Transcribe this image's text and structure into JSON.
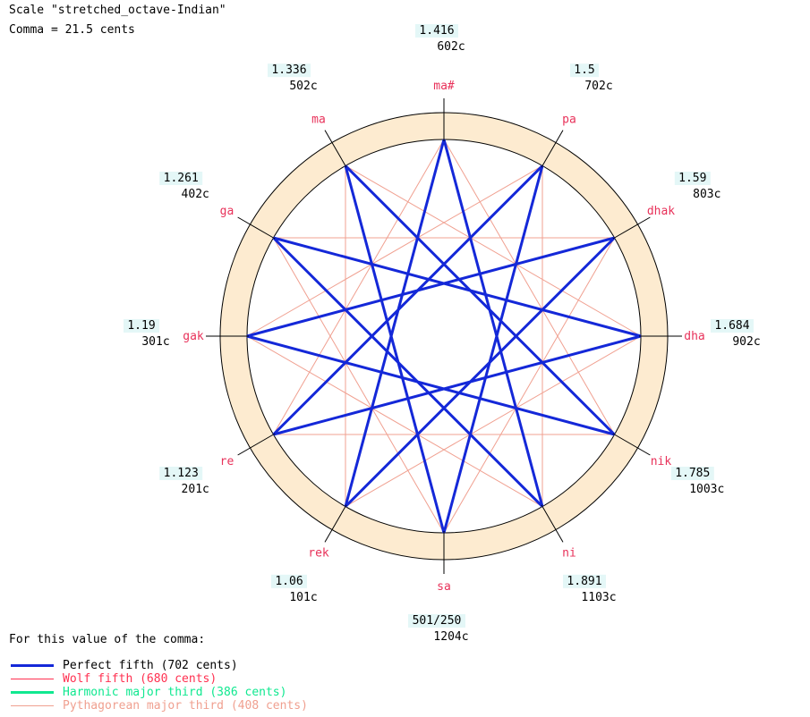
{
  "header": {
    "scale_line": "Scale \"stretched_octave-Indian\"",
    "comma_line": "Comma = 21.5 cents"
  },
  "colors": {
    "ring_fill": "#fdebd0",
    "note_label": "#e8325a",
    "ratio_bg": "#e4f7f7",
    "perfect_fifth": "#1428d8",
    "wolf_fifth": "#ff3050",
    "harmonic_third": "#10e890",
    "pythagorean_third": "#f0a090",
    "tick": "#000000"
  },
  "notes": [
    {
      "name": "sa",
      "ratio": "501/250",
      "cents": "1204c"
    },
    {
      "name": "rek",
      "ratio": "1.06",
      "cents": "101c"
    },
    {
      "name": "re",
      "ratio": "1.123",
      "cents": "201c"
    },
    {
      "name": "gak",
      "ratio": "1.19",
      "cents": "301c"
    },
    {
      "name": "ga",
      "ratio": "1.261",
      "cents": "402c"
    },
    {
      "name": "ma",
      "ratio": "1.336",
      "cents": "502c"
    },
    {
      "name": "ma#",
      "ratio": "1.416",
      "cents": "602c"
    },
    {
      "name": "pa",
      "ratio": "1.5",
      "cents": "702c"
    },
    {
      "name": "dhak",
      "ratio": "1.59",
      "cents": "803c"
    },
    {
      "name": "dha",
      "ratio": "1.684",
      "cents": "902c"
    },
    {
      "name": "nik",
      "ratio": "1.785",
      "cents": "1003c"
    },
    {
      "name": "ni",
      "ratio": "1.891",
      "cents": "1103c"
    }
  ],
  "perfect_fifths": [
    [
      0,
      7
    ],
    [
      7,
      2
    ],
    [
      2,
      9
    ],
    [
      9,
      4
    ],
    [
      4,
      11
    ],
    [
      11,
      6
    ],
    [
      6,
      1
    ],
    [
      1,
      8
    ],
    [
      8,
      3
    ],
    [
      3,
      10
    ],
    [
      10,
      5
    ],
    [
      5,
      0
    ]
  ],
  "pythagorean_thirds": [
    [
      0,
      4
    ],
    [
      4,
      8
    ],
    [
      8,
      0
    ],
    [
      1,
      5
    ],
    [
      5,
      9
    ],
    [
      9,
      1
    ],
    [
      2,
      6
    ],
    [
      6,
      10
    ],
    [
      10,
      2
    ],
    [
      3,
      7
    ],
    [
      7,
      11
    ],
    [
      11,
      3
    ]
  ],
  "legend": {
    "title": "For this value of the comma:",
    "items": [
      {
        "label": "Perfect fifth (702 cents)",
        "color": "#1428d8",
        "width": 3
      },
      {
        "label": "Wolf fifth (680 cents)",
        "color": "#ff3050",
        "width": 1
      },
      {
        "label": "Harmonic major third (386 cents)",
        "color": "#10e890",
        "width": 3
      },
      {
        "label": "Pythagorean major third (408 cents)",
        "color": "#f0a090",
        "width": 1
      }
    ]
  }
}
